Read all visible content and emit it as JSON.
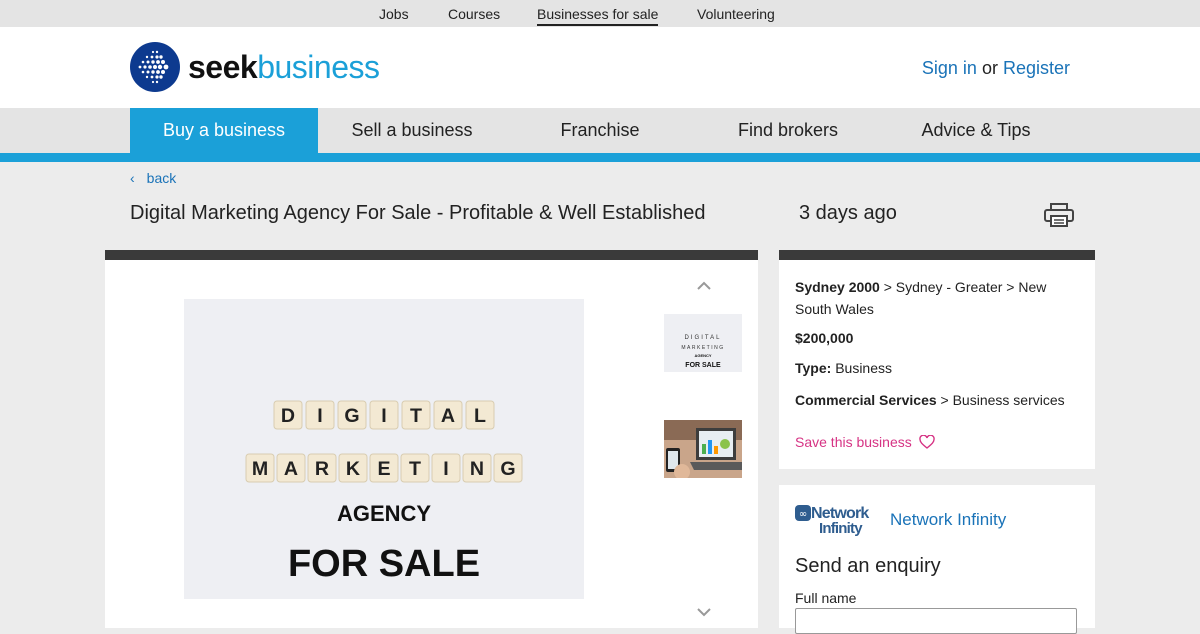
{
  "top_links": [
    "Jobs",
    "Courses",
    "Businesses for sale",
    "Volunteering"
  ],
  "top_links_active": "Businesses for sale",
  "logo": {
    "seek": "seek",
    "business": "business"
  },
  "auth": {
    "sign_in": "Sign in",
    "or": "or",
    "register": "Register"
  },
  "nav": [
    "Buy a business",
    "Sell a business",
    "Franchise",
    "Find brokers",
    "Advice & Tips"
  ],
  "nav_active": "Buy a business",
  "back_label": "back",
  "listing": {
    "title": "Digital Marketing Agency For Sale - Profitable & Well Established",
    "posted": "3 days ago",
    "main_image_words": [
      "DIGITAL",
      "MARKETING",
      "AGENCY",
      "FOR SALE"
    ],
    "thumb1_words": [
      "DIGITAL",
      "MARKETING",
      "AGENCY",
      "FOR SALE"
    ]
  },
  "details": {
    "location_bold": "Sydney 2000",
    "location_rest": " > Sydney - Greater > New South Wales",
    "price": "$200,000",
    "type_label": "Type:",
    "type_value": " Business",
    "category_bold": "Commercial Services",
    "category_rest": " > Business services",
    "save_label": "Save this business"
  },
  "enquiry": {
    "logo_line1": "Network",
    "logo_line2": "Infinity",
    "agency_name": "Network Infinity",
    "title": "Send an enquiry",
    "full_name_label": "Full name"
  },
  "colors": {
    "brand_blue": "#1ba0d8",
    "link_blue": "#1a73b8",
    "save_pink": "#d63384",
    "dark_bar": "#3a3a3a"
  },
  "icons": [
    "seek-logo-icon",
    "back-chevron-icon",
    "print-icon",
    "up-arrow-icon",
    "down-arrow-icon",
    "heart-icon",
    "network-infinity-logo"
  ]
}
